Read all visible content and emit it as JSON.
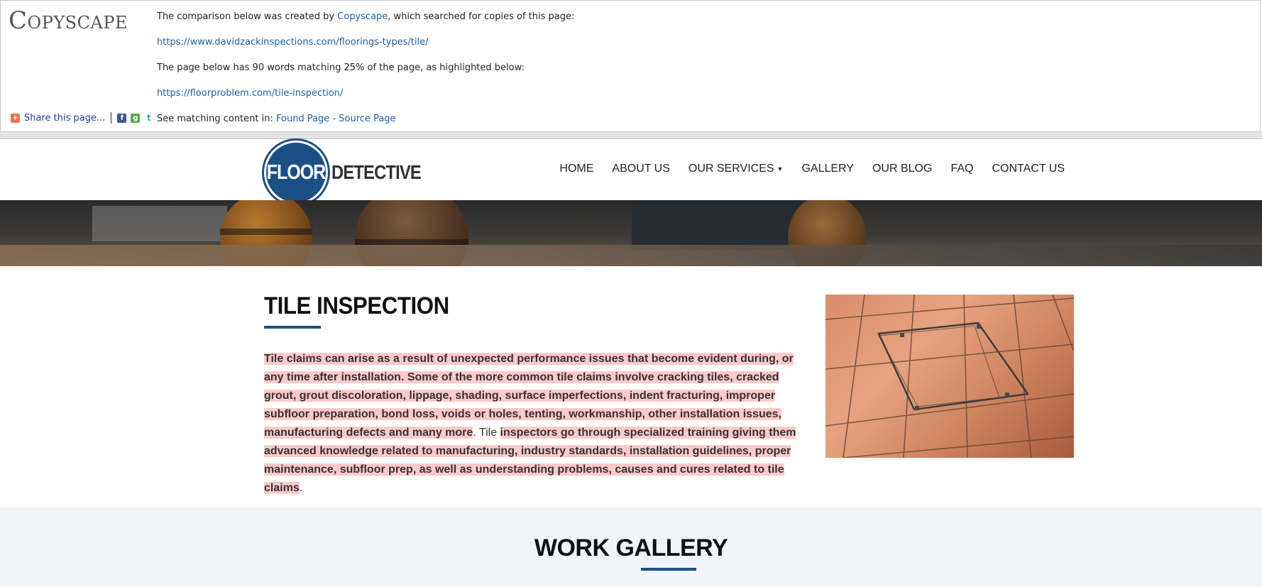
{
  "copyscape": {
    "logo": "Copyscape",
    "intro_prefix": "The comparison below was created by ",
    "intro_link": "Copyscape",
    "intro_suffix": ", which searched for copies of this page:",
    "source_url": "https://www.davidzackinspections.com/floorings-types/tile/",
    "match_summary": "The page below has 90 words matching 25% of the page, as highlighted below:",
    "found_url": "https://floorproblem.com/tile-inspection/",
    "see_matching_prefix": "See matching content in: ",
    "found_page_link": "Found Page",
    "link_separator": " - ",
    "source_page_link": "Source Page",
    "share_label": "Share this page...",
    "share_icons": [
      "share-plus-icon",
      "facebook-icon",
      "google-icon",
      "twitter-icon"
    ]
  },
  "site": {
    "logo_floor": "FLOOR",
    "logo_detective": "DETECTIVE",
    "nav": [
      {
        "label": "HOME"
      },
      {
        "label": "ABOUT US"
      },
      {
        "label": "OUR SERVICES"
      },
      {
        "label": "GALLERY"
      },
      {
        "label": "OUR BLOG"
      },
      {
        "label": "FAQ"
      },
      {
        "label": "CONTACT US"
      }
    ],
    "brand_color": "#1c4f86"
  },
  "content": {
    "title": "TILE INSPECTION",
    "p1_highlight": "Tile claims can arise as a result of unexpected performance issues that become evident during, or any time after installation.  Some of the more common tile claims involve cracking tiles, cracked grout, grout discoloration, lippage, shading, surface imperfections, indent fracturing, improper subfloor preparation, bond loss, voids or holes, tenting, workmanship, other installation issues, manufacturing defects and many more",
    "p1_plain": ".  Tile ",
    "p2_highlight": "inspectors go through specialized training giving them advanced knowledge related to manufacturing, industry standards, installation guidelines, proper maintenance, subfloor prep, as well as understanding problems, causes and cures related to tile claims",
    "p2_end": ".",
    "highlight_color": "#ffc9c9"
  },
  "gallery": {
    "title": "WORK GALLERY"
  }
}
